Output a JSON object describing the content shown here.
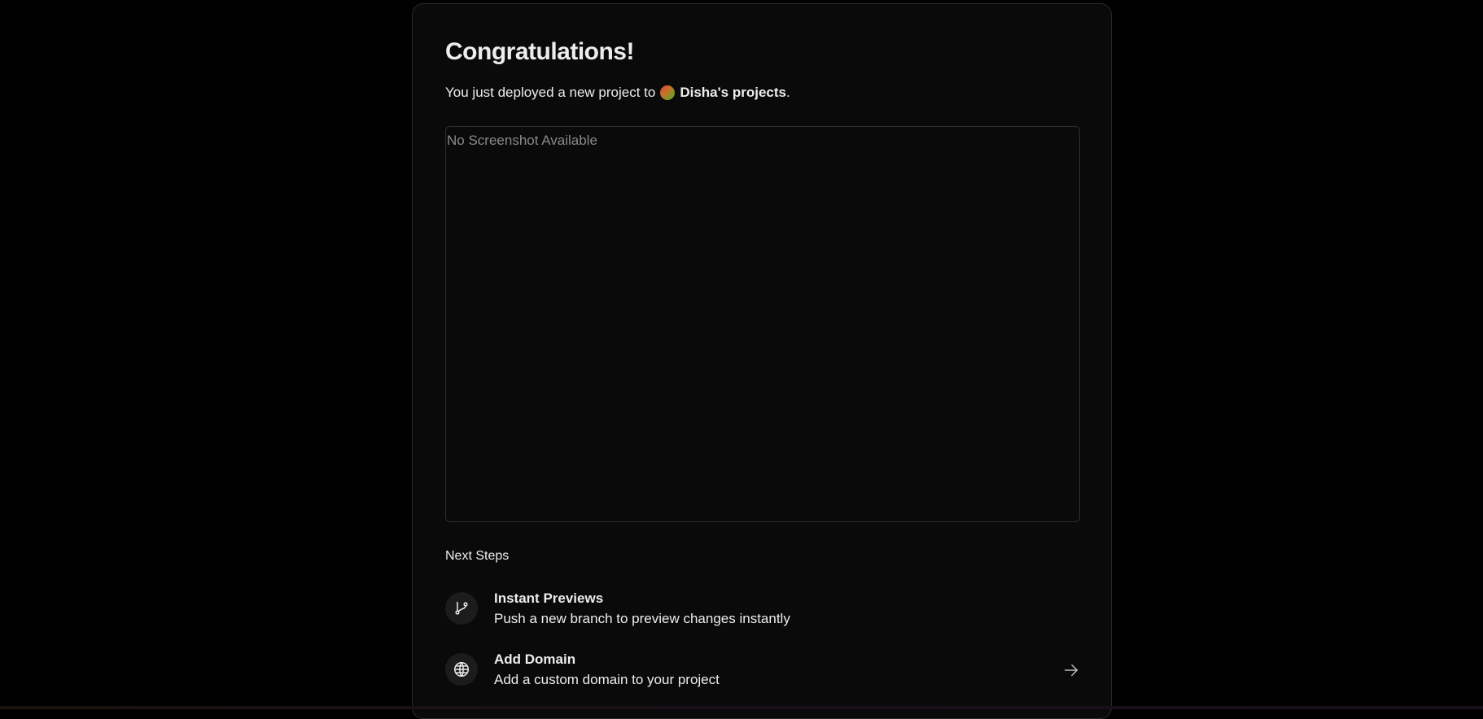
{
  "header": {
    "title": "Congratulations!",
    "subtitle_prefix": "You just deployed a new project to",
    "team_name": "Disha's projects",
    "subtitle_suffix": "."
  },
  "screenshot": {
    "placeholder_text": "No Screenshot Available"
  },
  "next_steps": {
    "label": "Next Steps",
    "items": [
      {
        "title": "Instant Previews",
        "description": "Push a new branch to preview changes instantly",
        "icon": "git-branch-icon"
      },
      {
        "title": "Add Domain",
        "description": "Add a custom domain to your project",
        "icon": "globe-icon",
        "action_icon": "arrow-right-icon"
      }
    ]
  },
  "colors": {
    "background": "#000000",
    "card": "#0a0a0a",
    "text": "#ededed",
    "muted": "#8a8a8a"
  }
}
